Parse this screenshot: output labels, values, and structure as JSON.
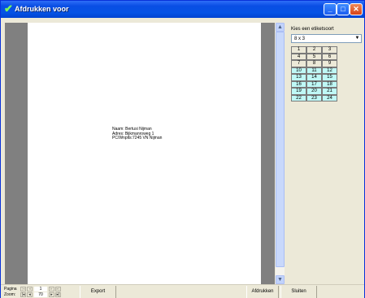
{
  "window": {
    "title": "Afdrukken voor",
    "minimize": "_",
    "maximize": "□",
    "close": "✕"
  },
  "preview": {
    "address_lines": [
      "Naam: Bertusi Nijman",
      "Adres: Bijkmanroweg 1",
      "PC/Wnplts:7245  VN  Nijman"
    ]
  },
  "scrollbar": {
    "up": "▲",
    "down": "▼"
  },
  "sidebar": {
    "label": "Kies een etiketsoort",
    "select_value": "8 x 3",
    "select_arrow": "▼",
    "cells": [
      [
        "1",
        "2",
        "3"
      ],
      [
        "4",
        "5",
        "6"
      ],
      [
        "7",
        "8",
        "9"
      ],
      [
        "10",
        "11",
        "12"
      ],
      [
        "13",
        "14",
        "15"
      ],
      [
        "16",
        "17",
        "18"
      ],
      [
        "19",
        "20",
        "21"
      ],
      [
        "22",
        "23",
        "24"
      ]
    ],
    "highlight_color": "#bff8f6"
  },
  "bottom": {
    "pagina_label": "Pagina",
    "zoom_label": "Zoom:",
    "page_value": "1",
    "zoom_value": "70",
    "nav_first": "|◂",
    "nav_prev": "◂",
    "nav_next": "▸",
    "nav_last": "▸|",
    "export": "Export",
    "afdrukken": "Afdrukken",
    "sluiten": "Sluiten"
  }
}
